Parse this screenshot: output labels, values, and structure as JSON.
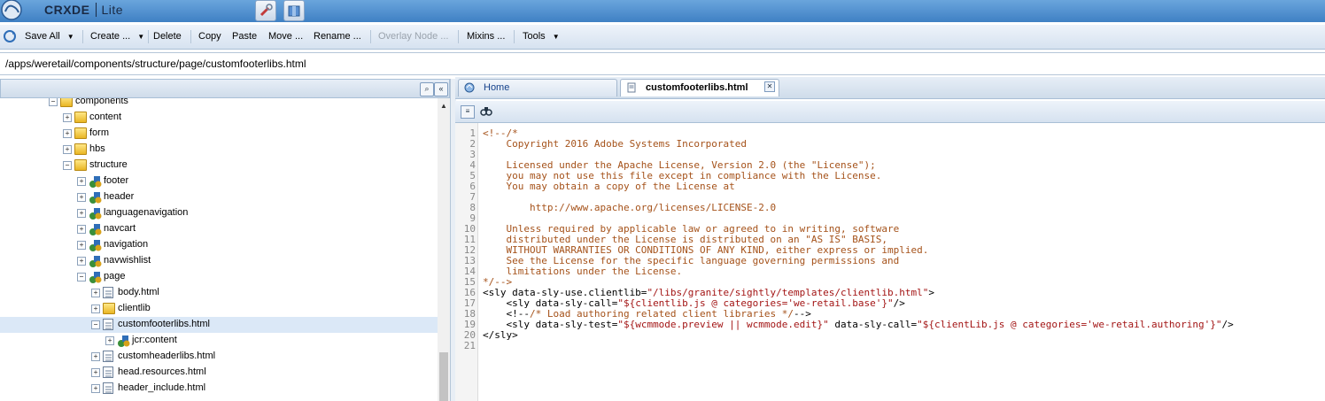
{
  "app": {
    "name": "CRXDE",
    "name_suffix": "Lite"
  },
  "toolbar": {
    "items": [
      {
        "label": "Save All",
        "dropdown": true
      },
      {
        "label": "Create ...",
        "dropdown": true
      },
      {
        "label": "Delete"
      },
      {
        "label": "Copy"
      },
      {
        "label": "Paste"
      },
      {
        "label": "Move ..."
      },
      {
        "label": "Rename ..."
      },
      {
        "label": "Overlay Node ...",
        "disabled": true
      },
      {
        "label": "Mixins ..."
      },
      {
        "label": "Tools",
        "dropdown": true
      }
    ]
  },
  "path": {
    "value": "/apps/weretail/components/structure/page/customfooterlibs.html"
  },
  "tree": {
    "rows": [
      {
        "label": "components",
        "icon": "folder-icon",
        "expanded": true
      },
      {
        "label": "content",
        "icon": "folder-icon",
        "expanded": false
      },
      {
        "label": "form",
        "icon": "folder-icon",
        "expanded": false
      },
      {
        "label": "hbs",
        "icon": "folder-icon",
        "expanded": false
      },
      {
        "label": "structure",
        "icon": "folder-icon",
        "expanded": true
      },
      {
        "label": "footer",
        "icon": "component-icon",
        "expanded": false
      },
      {
        "label": "header",
        "icon": "component-icon",
        "expanded": false
      },
      {
        "label": "languagenavigation",
        "icon": "component-icon",
        "expanded": false
      },
      {
        "label": "navcart",
        "icon": "component-icon",
        "expanded": false
      },
      {
        "label": "navigation",
        "icon": "component-icon",
        "expanded": false
      },
      {
        "label": "navwishlist",
        "icon": "component-icon",
        "expanded": false
      },
      {
        "label": "page",
        "icon": "component-icon",
        "expanded": true
      },
      {
        "label": "body.html",
        "icon": "file-icon",
        "expanded": false
      },
      {
        "label": "clientlib",
        "icon": "folder-icon",
        "expanded": false
      },
      {
        "label": "customfooterlibs.html",
        "icon": "file-icon",
        "expanded": true,
        "selected": true
      },
      {
        "label": "jcr:content",
        "icon": "component-icon",
        "expanded": false
      },
      {
        "label": "customheaderlibs.html",
        "icon": "file-icon",
        "expanded": false
      },
      {
        "label": "head.resources.html",
        "icon": "file-icon",
        "expanded": false
      },
      {
        "label": "header_include.html",
        "icon": "file-icon",
        "expanded": false
      }
    ]
  },
  "tabs": [
    {
      "label": "Home",
      "icon": "home-icon",
      "active": false
    },
    {
      "label": "customfooterlibs.html",
      "icon": "file-icon",
      "active": true,
      "closable": true
    }
  ],
  "editor": {
    "line_numbers": [
      "1",
      "2",
      "3",
      "4",
      "5",
      "6",
      "7",
      "8",
      "9",
      "10",
      "11",
      "12",
      "13",
      "14",
      "15",
      "16",
      "17",
      "18",
      "19",
      "20",
      "21"
    ],
    "lines": [
      "<!--/*",
      "    Copyright 2016 Adobe Systems Incorporated",
      "",
      "    Licensed under the Apache License, Version 2.0 (the \"License\");",
      "    you may not use this file except in compliance with the License.",
      "    You may obtain a copy of the License at",
      "",
      "        http://www.apache.org/licenses/LICENSE-2.0",
      "",
      "    Unless required by applicable law or agreed to in writing, software",
      "    distributed under the License is distributed on an \"AS IS\" BASIS,",
      "    WITHOUT WARRANTIES OR CONDITIONS OF ANY KIND, either express or implied.",
      "    See the License for the specific language governing permissions and",
      "    limitations under the License.",
      "*/-->",
      "<sly data-sly-use.clientlib=\"/libs/granite/sightly/templates/clientlib.html\">",
      "    <sly data-sly-call=\"${clientlib.js @ categories='we-retail.base'}\"/>",
      "    <!--/* Load authoring related client libraries */-->",
      "    <sly data-sly-test=\"${wcmmode.preview || wcmmode.edit}\" data-sly-call=\"${clientLib.js @ categories='we-retail.authoring'}\"/>",
      "</sly>",
      ""
    ]
  }
}
